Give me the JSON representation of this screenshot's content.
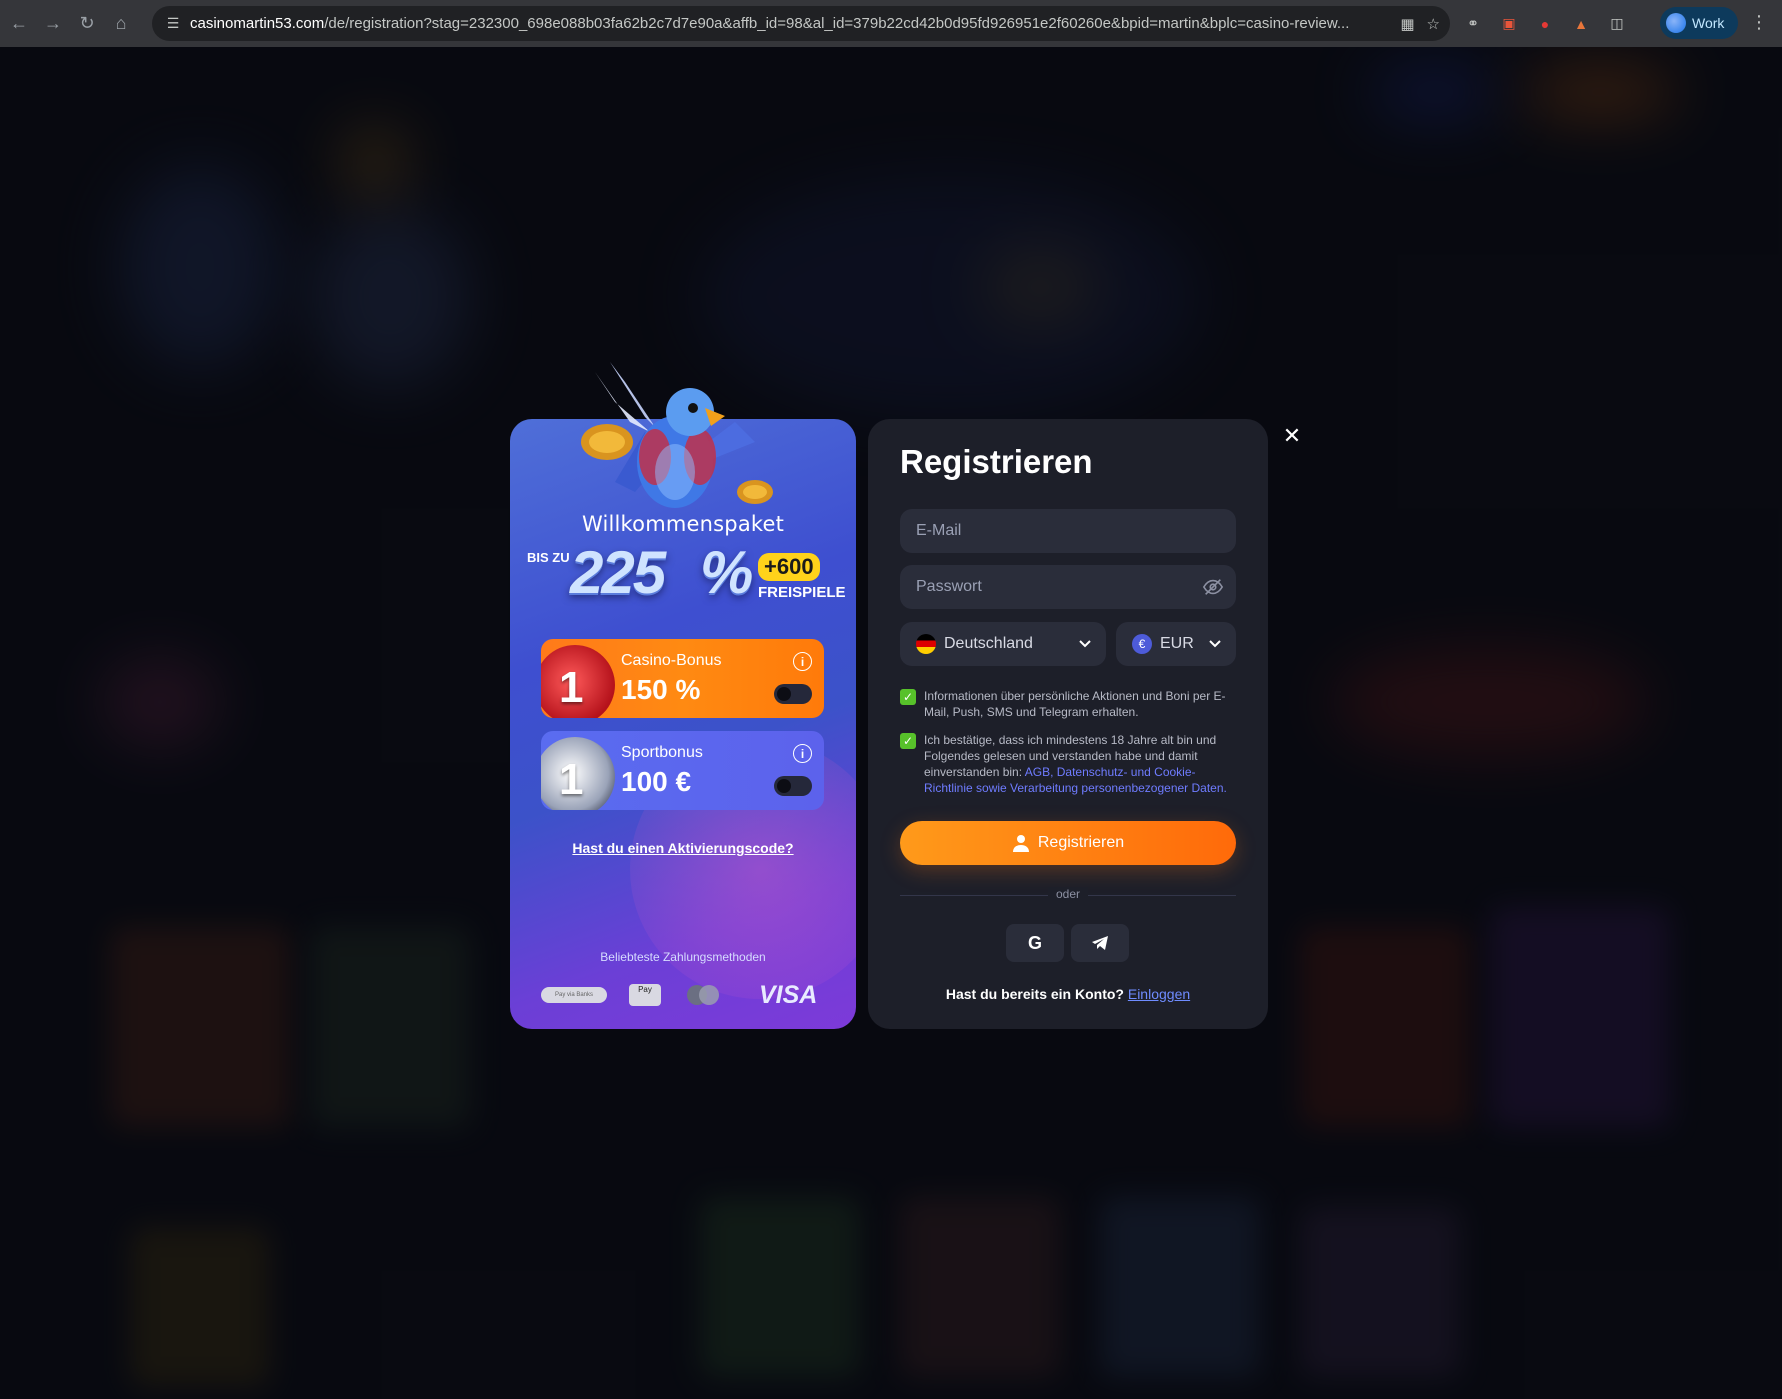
{
  "browser": {
    "url_host": "casinomartin53.com",
    "url_rest": "/de/registration?stag=232300_698e088b03fa62b2c7d7e90a&affb_id=98&al_id=379b22cd42b0d95fd926951e2f60260e&bpid=martin&bplc=casino-review...",
    "profile_label": "Work"
  },
  "promo": {
    "welcome": "Willkommenspaket",
    "bis_zu": "BIS ZU",
    "percent_value": "225",
    "percent_sign": "%",
    "freespins_amount": "+600",
    "freespins_label": "FREISPIELE",
    "bonuses": [
      {
        "title": "Casino-Bonus",
        "value": "150 %",
        "rank": "1",
        "enabled": false
      },
      {
        "title": "Sportbonus",
        "value": "100 €",
        "rank": "1",
        "enabled": false
      }
    ],
    "activation_link": "Hast du einen Aktivierungscode?",
    "payments_title": "Beliebteste Zahlungsmethoden",
    "payments": [
      "Pay via Banks",
      "Pay",
      "mastercard",
      "VISA"
    ]
  },
  "form": {
    "title": "Registrieren",
    "email_placeholder": "E-Mail",
    "password_placeholder": "Passwort",
    "country": "Deutschland",
    "currency": "EUR",
    "currency_symbol": "€",
    "consent1": "Informationen über persönliche Aktionen und Boni per E-Mail, Push, SMS und Telegram erhalten.",
    "consent2_prefix": "Ich bestätige, dass ich mindestens 18 Jahre alt bin und Folgendes gelesen und verstanden habe und damit einverstanden bin: ",
    "consent2_link": "AGB, Datenschutz- und Cookie-Richtlinie sowie Verarbeitung personenbezogener Daten.",
    "consent1_checked": true,
    "consent2_checked": true,
    "register_button": "Registrieren",
    "or_text": "oder",
    "have_account": "Hast du bereits ein Konto?",
    "login_link": "Einloggen"
  },
  "colors": {
    "accent_orange": "#ff7a0a",
    "panel": "#1d1f29",
    "checkbox": "#57c12a",
    "link": "#6f7cff"
  }
}
